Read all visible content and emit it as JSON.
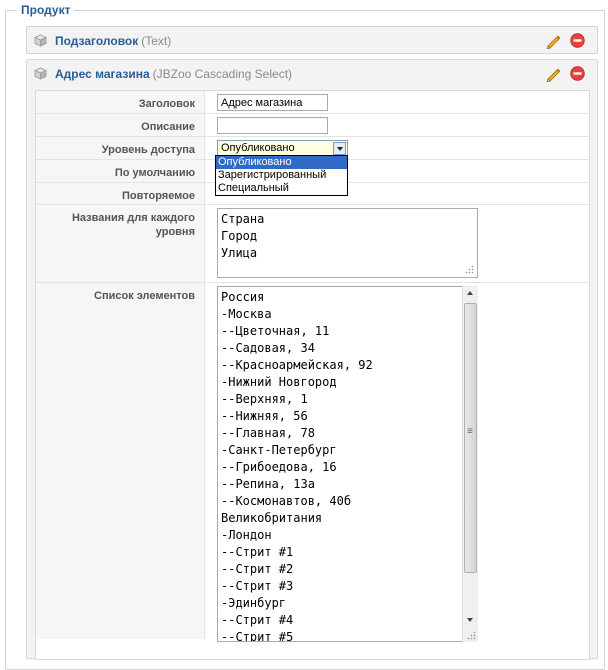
{
  "section": {
    "legend": "Продукт"
  },
  "element1": {
    "name": "Подзаголовок",
    "type": "(Text)"
  },
  "element2": {
    "name": "Адрес магазина",
    "type": "(JBZoo Cascading Select)"
  },
  "params": {
    "title_label": "Заголовок",
    "title_value": "Адрес магазина",
    "desc_label": "Описание",
    "desc_value": "",
    "access_label": "Уровень доступа",
    "access_value": "Опубликовано",
    "access_options": [
      "Опубликовано",
      "Зарегистрированный",
      "Специальный"
    ],
    "default_label": "По умолчанию",
    "repeat_label": "Повторяемое",
    "levels_label": "Названия для каждого уровня",
    "levels_value": "Страна\nГород\nУлица",
    "items_label": "Список элементов",
    "items_value": "Россия\n-Москва\n--Цветочная, 11\n--Садовая, 34\n--Красноармейская, 92\n-Нижний Новгород\n--Верхняя, 1\n--Нижняя, 56\n--Главная, 78\n-Санкт-Петербург\n--Грибоедова, 16\n--Репина, 13а\n--Космонавтов, 40б\nВеликобритания\n-Лондон\n--Стрит #1\n--Стрит #2\n--Стрит #3\n-Эдинбург\n--Стрит #4\n--Стрит #5"
  },
  "colors": {
    "accent": "#2a5d93",
    "dropdown_selected": "#3169c6",
    "select_bg": "#ffffe0"
  }
}
